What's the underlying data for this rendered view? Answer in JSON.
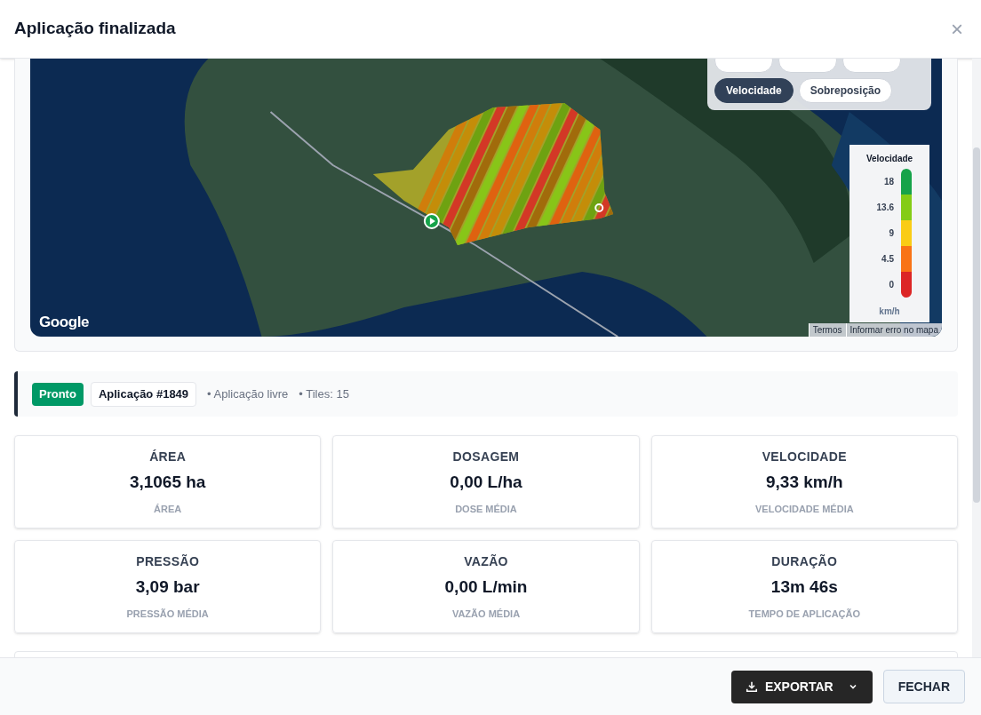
{
  "dialog": {
    "title": "Aplicação finalizada",
    "close": "×"
  },
  "map": {
    "logo": "Google",
    "layer_chips": [
      {
        "selected": false
      },
      {
        "selected": false
      },
      {
        "selected": false
      },
      {
        "label": "Velocidade",
        "selected": true
      },
      {
        "label": "Sobreposição",
        "selected": false
      }
    ],
    "legend": {
      "title": "Velocidade",
      "unit": "km/h",
      "stops": [
        {
          "label": "18",
          "color": "#16a34a"
        },
        {
          "label": "13.6",
          "color": "#84cc16"
        },
        {
          "label": "9",
          "color": "#facc15"
        },
        {
          "label": "4.5",
          "color": "#f97316"
        },
        {
          "label": "0",
          "color": "#dc2626"
        }
      ]
    },
    "attribution": [
      "Termos",
      "Informar erro no mapa"
    ]
  },
  "status": {
    "badge": "Pronto",
    "application": "Aplicação #1849",
    "details": [
      "• Aplicação livre",
      "• Tiles: 15"
    ]
  },
  "metrics": [
    {
      "title": "ÁREA",
      "value": "3,1065 ha",
      "caption": "ÁREA"
    },
    {
      "title": "DOSAGEM",
      "value": "0,00 L/ha",
      "caption": "DOSE MÉDIA"
    },
    {
      "title": "VELOCIDADE",
      "value": "9,33 km/h",
      "caption": "VELOCIDADE MÉDIA"
    },
    {
      "title": "PRESSÃO",
      "value": "3,09 bar",
      "caption": "PRESSÃO MÉDIA"
    },
    {
      "title": "VAZÃO",
      "value": "0,00 L/min",
      "caption": "VAZÃO MÉDIA"
    },
    {
      "title": "DURAÇÃO",
      "value": "13m 46s",
      "caption": "TEMPO DE APLICAÇÃO"
    }
  ],
  "footer": {
    "export": "EXPORTAR",
    "close": "FECHAR"
  }
}
